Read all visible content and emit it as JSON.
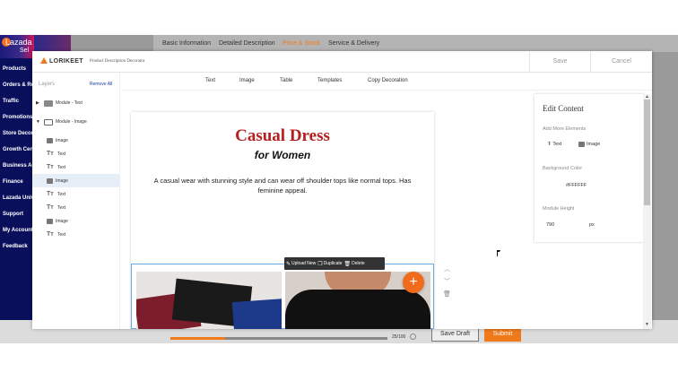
{
  "lazada": {
    "brand": "Lazada",
    "sub": "Sel",
    "nav": [
      "Products",
      "Orders & Re",
      "Traffic",
      "Promotions",
      "Store Decor",
      "Growth Cen",
      "Business Ad",
      "Finance",
      "Lazada Univ",
      "Support",
      "My Account",
      "Feedback"
    ]
  },
  "product_tabs": [
    "Basic Information",
    "Detailed Description",
    "Price & Stock",
    "Service & Delivery"
  ],
  "active_tab": "Price & Stock",
  "footer": {
    "progress_text": "25/100",
    "progress_fraction": 0.25,
    "save_draft": "Save Draft",
    "submit": "Submit"
  },
  "modal": {
    "brand": "LORIKEET",
    "app_title": "Product Description Decorator",
    "save": "Save",
    "cancel": "Cancel",
    "toolbar": [
      "Text",
      "Image",
      "Table",
      "Templates",
      "Copy Decoration"
    ]
  },
  "layers": {
    "title": "Layers",
    "remove_all": "Remove All",
    "module_text": "Module - Text",
    "module_image": "Module - Image",
    "children": [
      {
        "type": "image",
        "label": "Image",
        "selected": false
      },
      {
        "type": "text",
        "label": "Text",
        "selected": false
      },
      {
        "type": "text",
        "label": "Text",
        "selected": false
      },
      {
        "type": "image",
        "label": "Image",
        "selected": true
      },
      {
        "type": "text",
        "label": "Text",
        "selected": false
      },
      {
        "type": "text",
        "label": "Text",
        "selected": false
      },
      {
        "type": "image",
        "label": "Image",
        "selected": false
      },
      {
        "type": "text",
        "label": "Text",
        "selected": false
      }
    ]
  },
  "canvas": {
    "title": "Casual Dress",
    "subtitle": "for Women",
    "description": "A casual wear with stunning style and can wear off shoulder tops like normal tops. Has feminine appeal."
  },
  "float_toolbar": {
    "upload": "Upload New",
    "duplicate": "Duplicate",
    "delete": "Delete"
  },
  "edit_panel": {
    "title": "Edit Content",
    "add_more": "Add More Elements",
    "el_text": "Text",
    "el_image": "Image",
    "bg_label": "Background Color",
    "bg_value": "#FFFFFF",
    "height_label": "Module Height",
    "height_value": "790",
    "height_unit": "px"
  },
  "colors": {
    "accent": "#f07a1a",
    "title_red": "#b3201f",
    "lazada_navy": "#0a0f5c",
    "link_blue": "#1a3fa6"
  }
}
